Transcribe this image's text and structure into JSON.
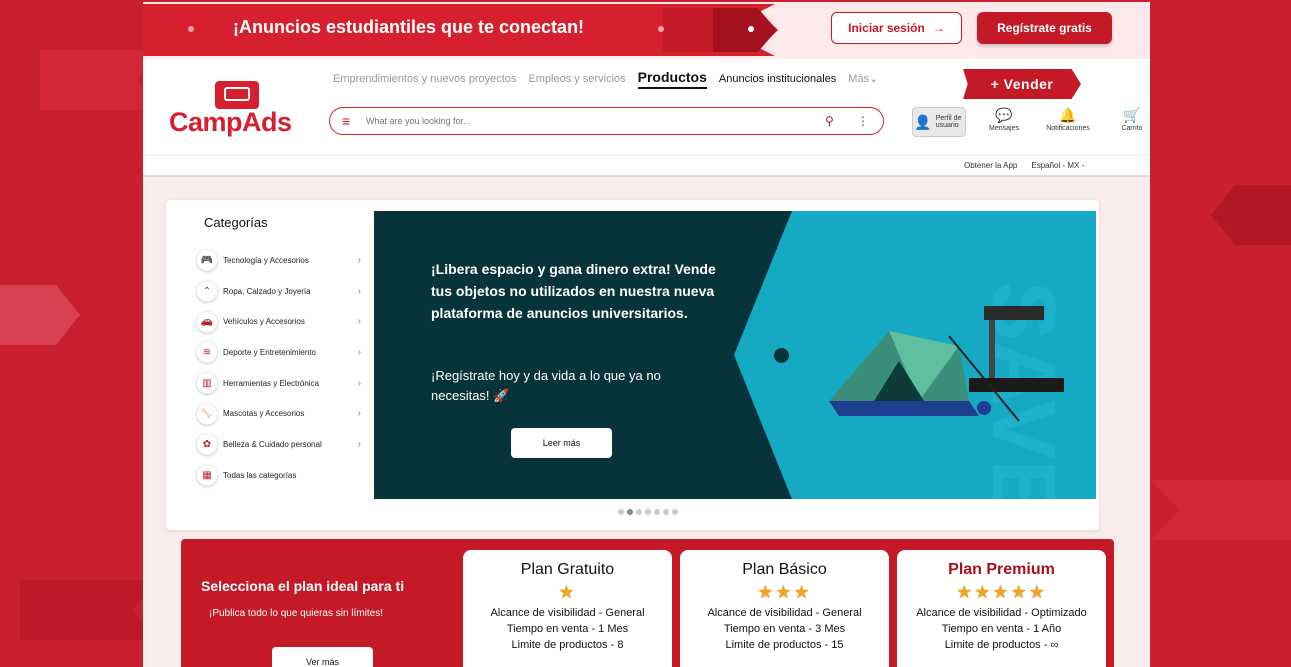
{
  "promo": {
    "text": "¡Anuncios estudiantiles que te conectan!",
    "login_label": "Iniciar sesión",
    "register_label": "Regístrate gratis"
  },
  "brand": {
    "name": "CampAds"
  },
  "nav": {
    "items": [
      "Emprendimientos y nuevos proyectos",
      "Empleos y servicios",
      "Productos",
      "Anuncios institucionales",
      "Más"
    ],
    "sell_label": "+ Vender"
  },
  "search": {
    "placeholder": "What are you looking for..."
  },
  "header_actions": {
    "profile": "Perfil de usuario",
    "messages": "Mensajes",
    "notifications": "Notificaciones",
    "cart": "Carrito"
  },
  "subbar": {
    "get_app": "Obtener la App",
    "language": "Español - MX -"
  },
  "categories": {
    "title": "Categorías",
    "items": [
      {
        "label": "Tecnología y Accesorios",
        "icon": "gamepad-icon"
      },
      {
        "label": "Ropa, Calzado y Joyería",
        "icon": "hanger-icon"
      },
      {
        "label": "Vehículos y Accesorios",
        "icon": "car-icon"
      },
      {
        "label": "Deporte y Entretenimiento",
        "icon": "swim-icon"
      },
      {
        "label": "Herramientas y Electrónica",
        "icon": "chip-icon"
      },
      {
        "label": "Mascotas y Accesorios",
        "icon": "bone-icon"
      },
      {
        "label": "Belleza &  Cuidado personal",
        "icon": "lotus-icon"
      },
      {
        "label": "Todas las categorías",
        "icon": "grid-icon"
      }
    ]
  },
  "banner": {
    "headline": "¡Libera espacio y gana dinero extra! Vende tus objetos no utilizados en nuestra nueva plataforma de anuncios universitarios.",
    "subtext": "¡Regístrate hoy y da vida a lo que ya no necesitas! 🚀",
    "button": "Leer más",
    "watermark": "SAVE",
    "active_slide": 2,
    "slides": 7
  },
  "plans": {
    "title": "Selecciona el plan ideal para ti",
    "subtitle": "¡Publica todo lo que quieras sin límites!",
    "button": "Ver más",
    "cards": [
      {
        "name": "Plan Gratuito",
        "stars": 1,
        "lines": [
          "Alcance de visibilidad - General",
          "Tiempo en venta - 1 Mes",
          "Limite de productos - 8"
        ]
      },
      {
        "name": "Plan Básico",
        "stars": 3,
        "lines": [
          "Alcance de visibilidad - General",
          "Tiempo en venta - 3 Mes",
          "Limite de productos - 15"
        ]
      },
      {
        "name": "Plan Premium",
        "stars": 5,
        "lines": [
          "Alcance de visibilidad - Optimizado",
          "Tiempo en venta - 1 Año",
          "Limite de productos -  ∞"
        ]
      }
    ]
  },
  "colors": {
    "brand_red": "#c41a28",
    "banner_dark": "#07333a",
    "banner_cyan": "#16a9c4",
    "star": "#f4a21f"
  }
}
